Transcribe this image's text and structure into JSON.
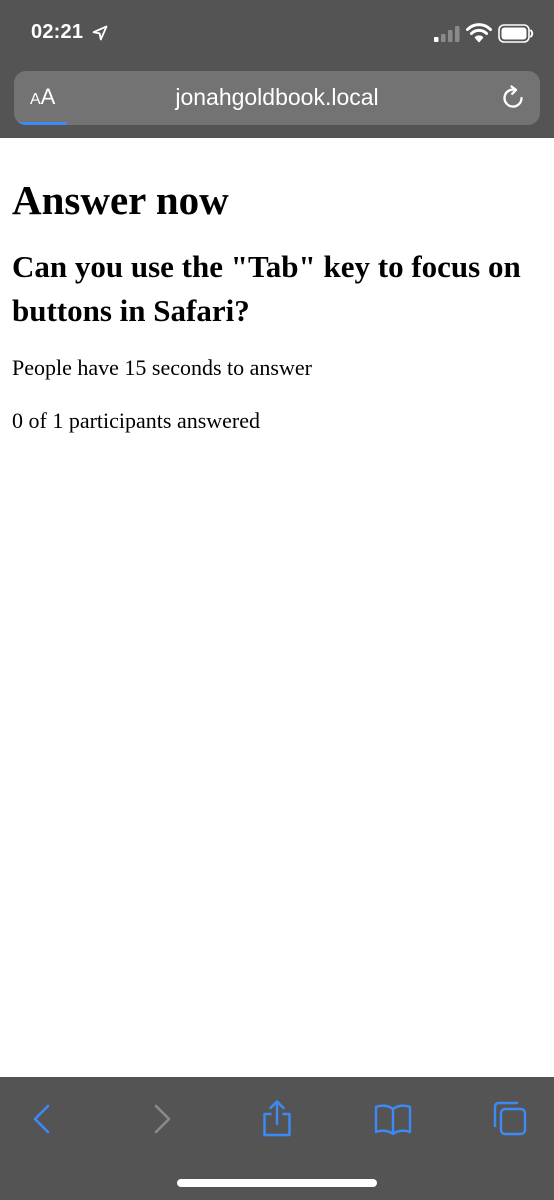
{
  "status_bar": {
    "time": "02:21",
    "icons": [
      "location-arrow-icon",
      "cellular-signal-icon",
      "wifi-icon",
      "battery-icon"
    ]
  },
  "address_bar": {
    "text_size_label_small": "A",
    "text_size_label_large": "A",
    "url": "jonahgoldbook.local",
    "load_progress": 0.1,
    "reload_icon": "reload-icon"
  },
  "page": {
    "heading": "Answer now",
    "question": "Can you use the \"Tab\" key to focus on buttons in Safari?",
    "time_info": "People have 15 seconds to answer",
    "participants_info": "0 of 1 participants answered"
  },
  "toolbar": {
    "buttons": [
      {
        "icon": "back-icon",
        "enabled": true
      },
      {
        "icon": "forward-icon",
        "enabled": false
      },
      {
        "icon": "share-icon",
        "enabled": true
      },
      {
        "icon": "bookmarks-icon",
        "enabled": true
      },
      {
        "icon": "tabs-icon",
        "enabled": true
      }
    ]
  },
  "colors": {
    "chrome_background": "#545454",
    "address_field": "#737373",
    "accent": "#3d8af7",
    "disabled": "#8a8a8a"
  }
}
